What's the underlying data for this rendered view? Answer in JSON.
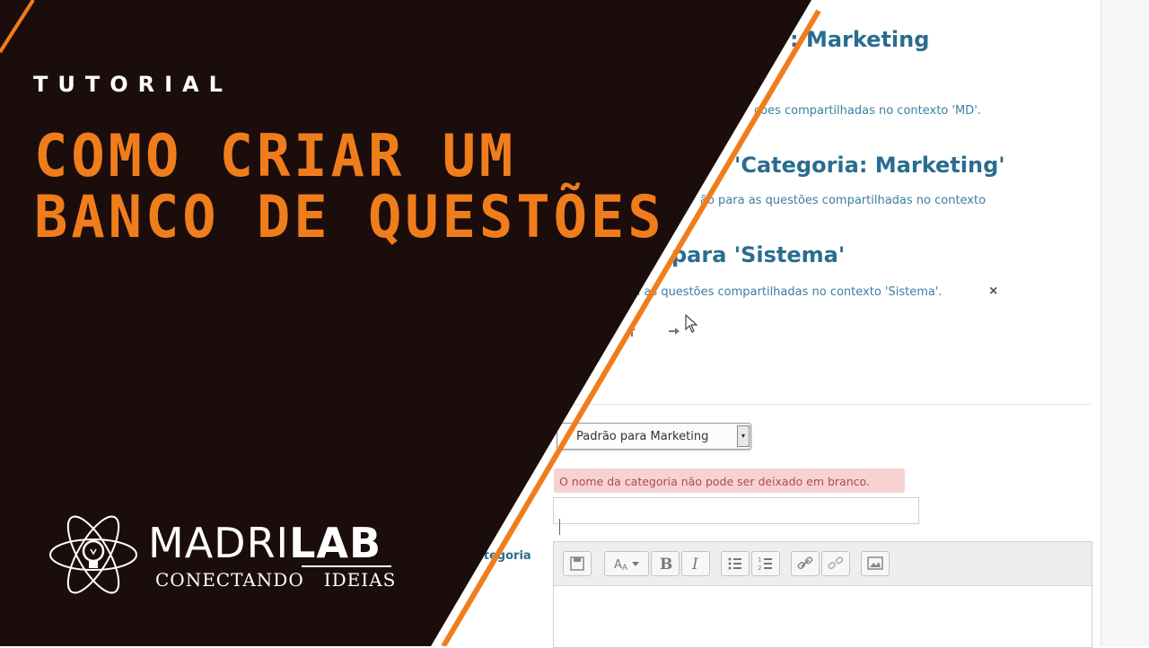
{
  "page": {
    "headings": [
      ": Marketing",
      "'Categoria: Marketing'",
      "para 'Sistema'"
    ],
    "descriptions": [
      "ções compartilhadas no contexto 'MD'.",
      "ão para as questões compartilhadas no contexto",
      "ra as questões compartilhadas no contexto 'Sistema'."
    ],
    "close_icon": "×",
    "parent_select_value": "Padrão para Marketing",
    "select_arrow": "▾",
    "error_message": "O nome da categoria não pode ser deixado em branco.",
    "side_label": "ategoria",
    "toolbar_icons": [
      "save-icon",
      "font-size-icon",
      "bold-icon",
      "italic-icon",
      "unordered-list-icon",
      "ordered-list-icon",
      "link-icon",
      "unlink-icon",
      "image-icon"
    ]
  },
  "overlay": {
    "kicker": "TUTORIAL",
    "title_line1": "COMO CRIAR UM",
    "title_line2": "BANCO DE QUESTÕES",
    "brand_part1": "MADRI",
    "brand_part2": "LAB",
    "tagline_part1": "CONECTANDO",
    "tagline_part2": "IDEIAS"
  },
  "colors": {
    "dark": "#1c0d0d",
    "orange": "#f07d1c",
    "link_blue": "#2a6d8f",
    "error_bg": "#f7d2d2"
  }
}
